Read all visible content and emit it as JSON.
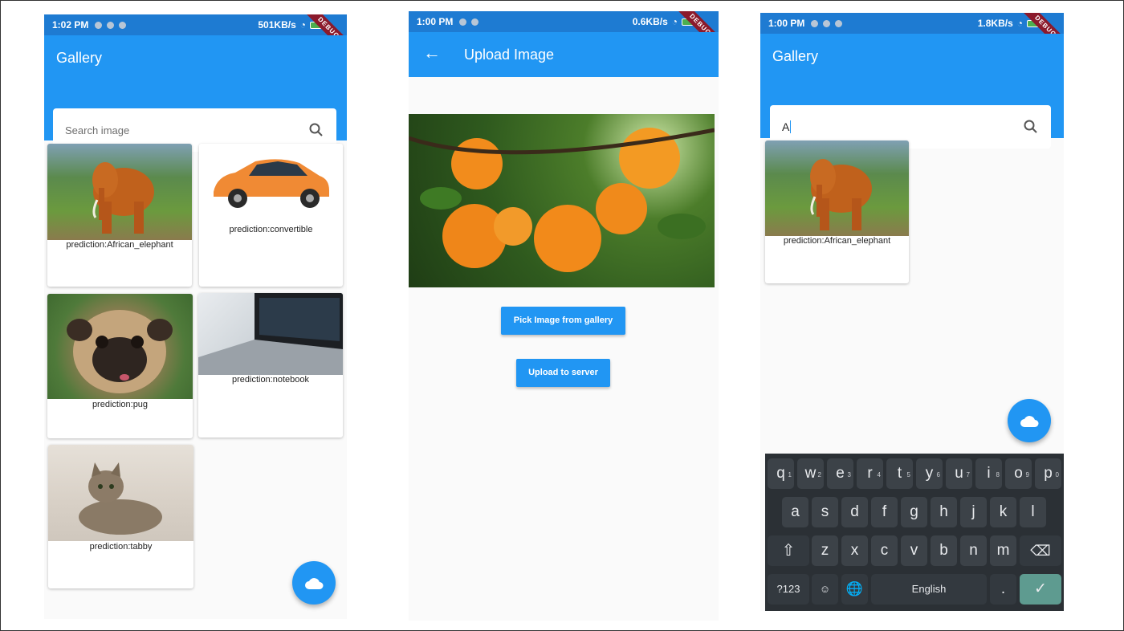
{
  "phone1": {
    "status": {
      "time": "1:02 PM",
      "speed": "501KB/s"
    },
    "debug": "DEBUG",
    "title": "Gallery",
    "search_placeholder": "Search image",
    "cards": [
      {
        "caption": "prediction:African_elephant",
        "image": "elephant"
      },
      {
        "caption": "prediction:convertible",
        "image": "car"
      },
      {
        "caption": "prediction:pug",
        "image": "pug"
      },
      {
        "caption": "prediction:notebook",
        "image": "laptop"
      },
      {
        "caption": "prediction:tabby",
        "image": "cat"
      }
    ],
    "fab_icon": "cloud-icon"
  },
  "phone2": {
    "status": {
      "time": "1:00 PM",
      "speed": "0.6KB/s"
    },
    "debug": "DEBUG",
    "title": "Upload Image",
    "back_icon": "arrow-back-icon",
    "image": "oranges",
    "pick_button": "Pick Image from gallery",
    "upload_button": "Upload to server"
  },
  "phone3": {
    "status": {
      "time": "1:00 PM",
      "speed": "1.8KB/s"
    },
    "debug": "DEBUG",
    "title": "Gallery",
    "search_value": "A",
    "cards": [
      {
        "caption": "prediction:African_elephant",
        "image": "elephant"
      }
    ],
    "fab_icon": "cloud-icon",
    "keyboard": {
      "row1": [
        [
          "q",
          "1"
        ],
        [
          "w",
          "2"
        ],
        [
          "e",
          "3"
        ],
        [
          "r",
          "4"
        ],
        [
          "t",
          "5"
        ],
        [
          "y",
          "6"
        ],
        [
          "u",
          "7"
        ],
        [
          "i",
          "8"
        ],
        [
          "o",
          "9"
        ],
        [
          "p",
          "0"
        ]
      ],
      "row2": [
        "a",
        "s",
        "d",
        "f",
        "g",
        "h",
        "j",
        "k",
        "l"
      ],
      "row3": [
        "z",
        "x",
        "c",
        "v",
        "b",
        "n",
        "m"
      ],
      "symbols_key": "?123",
      "space_label": "English",
      "period_key": "."
    }
  },
  "colors": {
    "appbar": "#2196f3",
    "statusbar": "#1e7bd2",
    "keyboard": "#2b3035",
    "enter_key": "#5e9b90"
  }
}
